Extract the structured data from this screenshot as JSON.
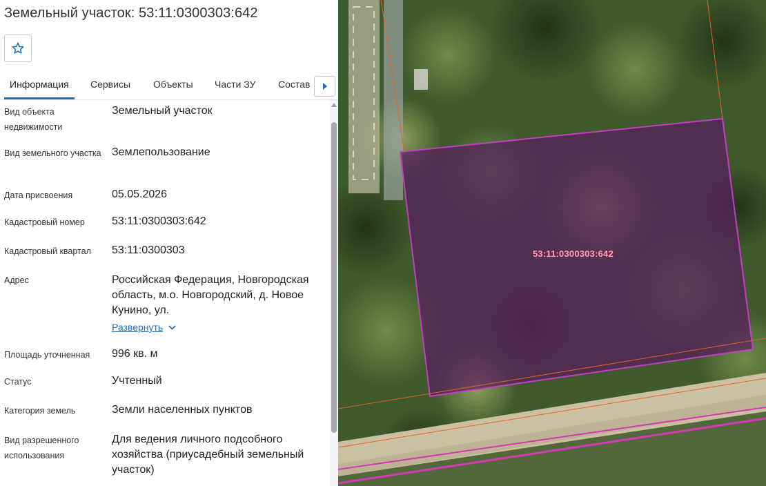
{
  "header": {
    "title": "Земельный участок: 53:11:0300303:642",
    "favorite_icon": "star-outline-icon"
  },
  "tabs": [
    {
      "label": "Информация",
      "active": true
    },
    {
      "label": "Сервисы",
      "active": false
    },
    {
      "label": "Объекты",
      "active": false
    },
    {
      "label": "Части ЗУ",
      "active": false
    },
    {
      "label": "Состав",
      "active": false
    }
  ],
  "tabs_next_icon": "caret-right-icon",
  "info": {
    "object_type": {
      "label": "Вид объекта недвижимости",
      "value": "Земельный участок"
    },
    "land_type": {
      "label": "Вид земельного участка",
      "value": "Землепользование"
    },
    "assign_date": {
      "label": "Дата присвоения",
      "value": "05.05.2026"
    },
    "cadastral_number": {
      "label": "Кадастровый номер",
      "value": "53:11:0300303:642"
    },
    "cadastral_quarter": {
      "label": "Кадастровый квартал",
      "value": "53:11:0300303"
    },
    "address": {
      "label": "Адрес",
      "value": "Российская Федерация, Новгородская область, м.о. Новгородский, д. Новое Кунино, ул.",
      "expand_label": "Развернуть"
    },
    "area": {
      "label": "Площадь уточненная",
      "value": "996 кв. м"
    },
    "status": {
      "label": "Статус",
      "value": "Учтенный"
    },
    "land_category": {
      "label": "Категория земель",
      "value": "Земли населенных пунктов"
    },
    "permitted_use": {
      "label": "Вид разрешенного использования",
      "value": "Для ведения личного подсобного хозяйства (приусадебный земельный участок)"
    }
  },
  "map": {
    "parcel_label": "53:11:0300303:642",
    "colors": {
      "parcel_fill": "#5a1f5e",
      "parcel_border": "#c040c0",
      "boundary_orange": "#e0642a",
      "road_pink": "#d33bb5",
      "road_surface": "#cbbfa2",
      "vegetation": "#3f5a2c"
    }
  },
  "colors": {
    "accent": "#1e6fb8",
    "text": "#222222"
  }
}
